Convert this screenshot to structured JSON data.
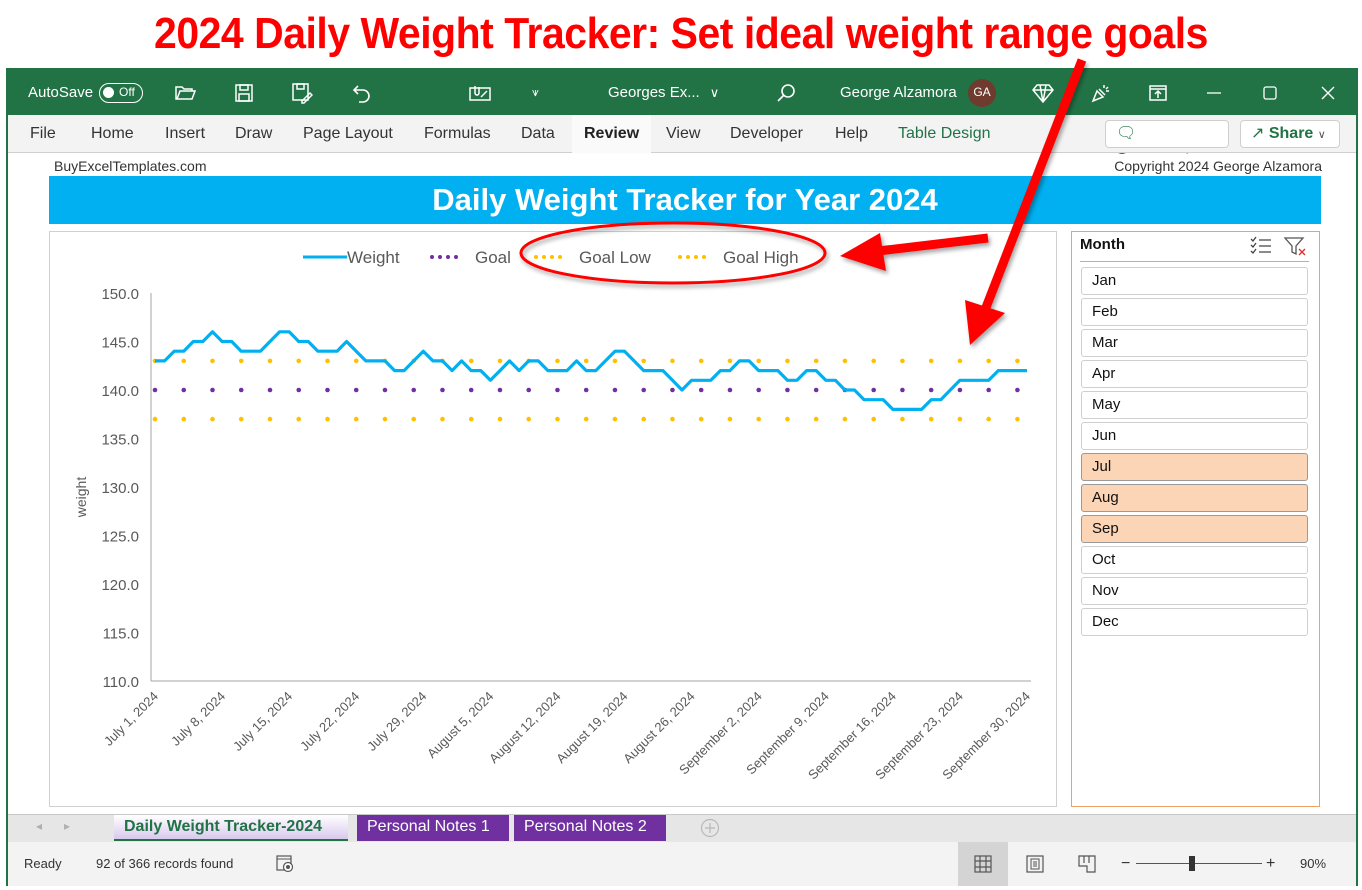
{
  "banner": {
    "text": "2024 Daily Weight Tracker: Set ideal weight range goals"
  },
  "titlebar": {
    "autosave_label": "AutoSave",
    "autosave_state": "Off",
    "file_name": "Georges  Ex...",
    "user_name": "George Alzamora",
    "user_initials": "GA"
  },
  "ribbon": {
    "tabs": [
      {
        "label": "File"
      },
      {
        "label": "Home"
      },
      {
        "label": "Insert"
      },
      {
        "label": "Draw"
      },
      {
        "label": "Page Layout"
      },
      {
        "label": "Formulas"
      },
      {
        "label": "Data"
      },
      {
        "label": "Review"
      },
      {
        "label": "View"
      },
      {
        "label": "Developer"
      },
      {
        "label": "Help"
      },
      {
        "label": "Table Design"
      }
    ],
    "active_tab": "Review",
    "comments_label": "Comments",
    "share_label": "Share"
  },
  "sheet": {
    "site": "BuyExcelTemplates.com",
    "copyright": "Copyright 2024  George Alzamora",
    "header_title": "Daily Weight Tracker for Year 2024"
  },
  "colors": {
    "weight": "#00b0f0",
    "goal": "#7030a0",
    "goal_low": "#ffc000",
    "goal_high": "#ffc000",
    "annotation": "#ff0000"
  },
  "chart_data": {
    "type": "line",
    "title": "",
    "xlabel": "",
    "ylabel": "weight",
    "ylim": [
      110,
      150
    ],
    "yticks": [
      "150.0",
      "145.0",
      "140.0",
      "135.0",
      "130.0",
      "125.0",
      "120.0",
      "115.0",
      "110.0"
    ],
    "xtick_labels": [
      "July 1, 2024",
      "July 8, 2024",
      "July 15, 2024",
      "July 22, 2024",
      "July 29, 2024",
      "August 5, 2024",
      "August 12, 2024",
      "August 19, 2024",
      "August 26, 2024",
      "September 2, 2024",
      "September 9, 2024",
      "September 16, 2024",
      "September 23, 2024",
      "September 30, 2024"
    ],
    "x_range": [
      "July 1, 2024",
      "September 30, 2024"
    ],
    "legend_position": "top",
    "series": [
      {
        "name": "Weight",
        "style": "solid",
        "values": [
          143,
          143,
          144,
          144,
          145,
          145,
          146,
          145,
          145,
          144,
          144,
          144,
          145,
          146,
          146,
          145,
          145,
          144,
          144,
          144,
          145,
          144,
          143,
          143,
          143,
          142,
          142,
          143,
          144,
          143,
          143,
          142,
          143,
          142,
          142,
          141,
          142,
          143,
          142,
          143,
          143,
          142,
          142,
          142,
          143,
          142,
          142,
          143,
          144,
          144,
          143,
          142,
          142,
          142,
          141,
          140,
          141,
          141,
          141,
          142,
          142,
          143,
          143,
          142,
          142,
          142,
          141,
          141,
          142,
          142,
          141,
          141,
          140,
          140,
          139,
          139,
          139,
          138,
          138,
          138,
          138,
          139,
          139,
          140,
          141,
          141,
          141,
          141,
          142,
          142,
          142,
          142
        ]
      },
      {
        "name": "Goal",
        "style": "dotted",
        "constant": 140
      },
      {
        "name": "Goal Low",
        "style": "dotted",
        "constant": 137
      },
      {
        "name": "Goal High",
        "style": "dotted",
        "constant": 143
      }
    ]
  },
  "slicer": {
    "title": "Month",
    "items": [
      {
        "label": "Jan",
        "selected": false
      },
      {
        "label": "Feb",
        "selected": false
      },
      {
        "label": "Mar",
        "selected": false
      },
      {
        "label": "Apr",
        "selected": false
      },
      {
        "label": "May",
        "selected": false
      },
      {
        "label": "Jun",
        "selected": false
      },
      {
        "label": "Jul",
        "selected": true
      },
      {
        "label": "Aug",
        "selected": true
      },
      {
        "label": "Sep",
        "selected": true
      },
      {
        "label": "Oct",
        "selected": false
      },
      {
        "label": "Nov",
        "selected": false
      },
      {
        "label": "Dec",
        "selected": false
      }
    ]
  },
  "sheet_tabs": [
    {
      "label": "Daily Weight Tracker-2024",
      "active": true
    },
    {
      "label": "Personal Notes 1",
      "active": false
    },
    {
      "label": "Personal Notes 2",
      "active": false
    }
  ],
  "status": {
    "ready": "Ready",
    "records": "92 of 366 records found",
    "zoom_percent": "90%",
    "zoom_value": 90
  }
}
